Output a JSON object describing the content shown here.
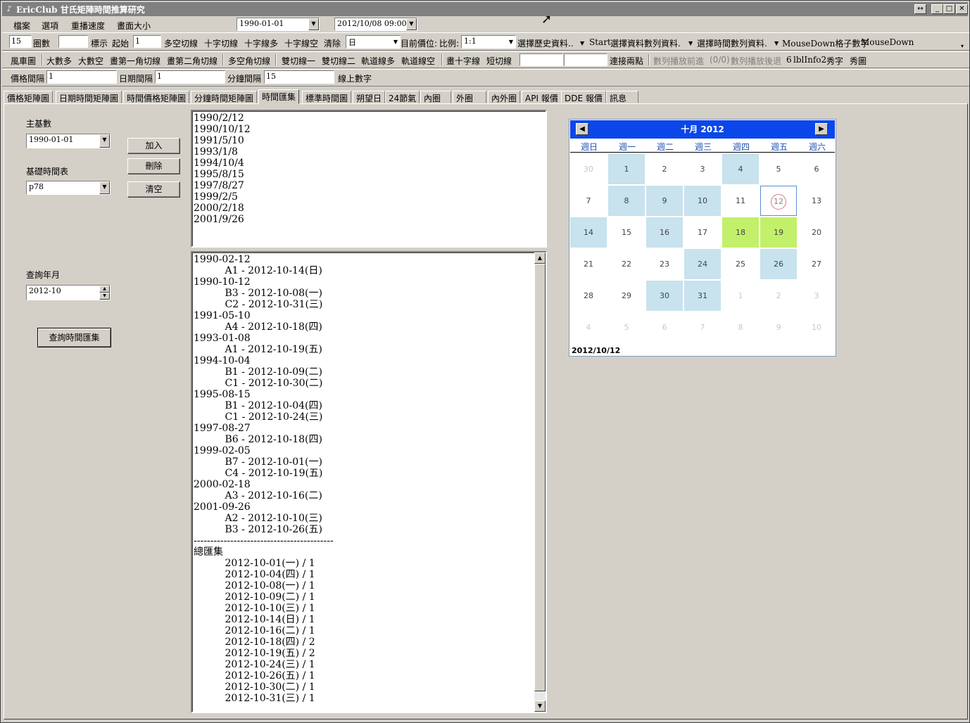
{
  "window": {
    "title": "EricClub 甘氏矩陣時間推算研究",
    "buttons": [
      "↔",
      "_",
      "□",
      "✕"
    ]
  },
  "menu": [
    "檔案",
    "選項",
    "重播速度",
    "畫面大小"
  ],
  "header": {
    "date_start": "1990-01-01",
    "date_end": "2012/10/08 09:00"
  },
  "toolbar1": {
    "grid_count": "15",
    "grid_count_label": "圈數",
    "mark_label": "標示",
    "start_label": "起始",
    "start_value": "1",
    "items": [
      "多空切線",
      "十字切線",
      "十字線多",
      "十字線空",
      "清除"
    ],
    "day_combo": "日",
    "price_label": "目前價位:",
    "ratio_label": "比例:",
    "ratio_value": "1:1",
    "history_combo": "選擇歷史資料..",
    "start_btn": "Start",
    "series_combo": "選擇資料數列資料.",
    "time_series_combo": "選擇時間數列資料.",
    "mousedown_label": "MouseDown格子數字",
    "mousedown_value": "MouseDown"
  },
  "toolbar2": {
    "items": [
      "風車圖",
      "大數多",
      "大數空",
      "畫第一角切線",
      "畫第二角切線",
      "多空角切線",
      "雙切線一",
      "雙切線二",
      "軌道線多",
      "軌道線空",
      "畫十字線",
      "短切線"
    ],
    "connect_label": "連接兩點",
    "play_forward": "數列播放前進",
    "counter": "(0/0)",
    "play_back": "數列播放後退",
    "info_num": "6",
    "info_label": "lblInfo2",
    "show_text": "秀字",
    "show_image": "秀圖"
  },
  "toolbar3": {
    "price_interval_label": "價格間隔",
    "price_interval_value": "1",
    "date_interval_label": "日期間隔",
    "date_interval_value": "1",
    "minute_interval_label": "分鐘間隔",
    "minute_interval_value": "15",
    "line_number_label": "線上數字"
  },
  "tabs": [
    "價格矩陣圖",
    "日期時間矩陣圖",
    "時間價格矩陣圖",
    "分鐘時間矩陣圖",
    "時間匯集",
    "標準時間圖",
    "朔望日",
    "24節氣",
    "內圈",
    "外圈",
    "內外圈",
    "API 報價",
    "DDE 報價",
    "訊息"
  ],
  "active_tab": "時間匯集",
  "form": {
    "main_base_label": "主基數",
    "main_base_value": "1990-01-01",
    "base_table_label": "基礎時間表",
    "base_table_value": "p78",
    "add_button": "加入",
    "delete_button": "刪除",
    "clear_button": "清空",
    "query_month_label": "查詢年月",
    "query_month_value": "2012-10",
    "query_button": "查詢時間匯集"
  },
  "base_dates": [
    "1990/2/12",
    "1990/10/12",
    "1991/5/10",
    "1993/1/8",
    "1994/10/4",
    "1995/8/15",
    "1997/8/27",
    "1999/2/5",
    "2000/2/18",
    "2001/9/26"
  ],
  "results": [
    "1990-02-12",
    "          A1 - 2012-10-14(日)",
    "1990-10-12",
    "          B3 - 2012-10-08(一)",
    "          C2 - 2012-10-31(三)",
    "1991-05-10",
    "          A4 - 2012-10-18(四)",
    "1993-01-08",
    "          A1 - 2012-10-19(五)",
    "1994-10-04",
    "          B1 - 2012-10-09(二)",
    "          C1 - 2012-10-30(二)",
    "1995-08-15",
    "          B1 - 2012-10-04(四)",
    "          C1 - 2012-10-24(三)",
    "1997-08-27",
    "          B6 - 2012-10-18(四)",
    "1999-02-05",
    "          B7 - 2012-10-01(一)",
    "          C4 - 2012-10-19(五)",
    "2000-02-18",
    "          A3 - 2012-10-16(二)",
    "2001-09-26",
    "          A2 - 2012-10-10(三)",
    "          B3 - 2012-10-26(五)",
    "------------------------------------------",
    "總匯集",
    "          2012-10-01(一) / 1",
    "          2012-10-04(四) / 1",
    "          2012-10-08(一) / 1",
    "          2012-10-09(二) / 1",
    "          2012-10-10(三) / 1",
    "          2012-10-14(日) / 1",
    "          2012-10-16(二) / 1",
    "          2012-10-18(四) / 2",
    "          2012-10-19(五) / 2",
    "          2012-10-24(三) / 1",
    "          2012-10-26(五) / 1",
    "          2012-10-30(二) / 1",
    "          2012-10-31(三) / 1"
  ],
  "calendar": {
    "title": "十月 2012",
    "weekdays": [
      "週日",
      "週一",
      "週二",
      "週三",
      "週四",
      "週五",
      "週六"
    ],
    "weeks": [
      [
        "30",
        "1",
        "2",
        "3",
        "4",
        "5",
        "6"
      ],
      [
        "7",
        "8",
        "9",
        "10",
        "11",
        "12",
        "13"
      ],
      [
        "14",
        "15",
        "16",
        "17",
        "18",
        "19",
        "20"
      ],
      [
        "21",
        "22",
        "23",
        "24",
        "25",
        "26",
        "27"
      ],
      [
        "28",
        "29",
        "30",
        "31",
        "1",
        "2",
        "3"
      ],
      [
        "4",
        "5",
        "6",
        "7",
        "8",
        "9",
        "10"
      ]
    ],
    "highlighted_days": [
      "1",
      "4",
      "8",
      "9",
      "10",
      "14",
      "16",
      "24",
      "26",
      "30",
      "31"
    ],
    "strong_days": [
      "18",
      "19"
    ],
    "today_day": "12",
    "footer": "2012/10/12",
    "highlight_color": "#c8e2ee",
    "strong_color": "#c2f06a",
    "header_color": "#0a46ea"
  }
}
